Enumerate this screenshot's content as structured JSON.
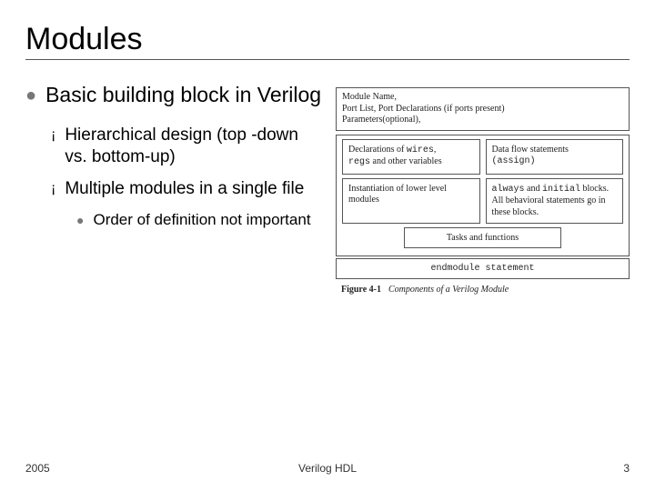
{
  "title": "Modules",
  "main_bullet": "Basic building block in Verilog",
  "sub": {
    "a": "Hierarchical design (top -down vs. bottom-up)",
    "b": "Multiple modules in a single file"
  },
  "subsub": "Order of definition not important",
  "footer": {
    "left": "2005",
    "center": "Verilog HDL",
    "right": "3"
  },
  "diagram": {
    "header_l1": "Module Name,",
    "header_l2": "Port List, Port Declarations (if ports present)",
    "header_l3": "Parameters(optional),",
    "row1": {
      "left_plain1": "Declarations of ",
      "left_mono1": "wires",
      "left_plain2": ",",
      "left_mono2": "regs",
      "left_plain3": " and other variables",
      "right_plain": "Data flow statements",
      "right_mono": "(assign)"
    },
    "row2": {
      "left": "Instantiation of lower level modules",
      "right_l1a": "always",
      "right_l1mid": " and ",
      "right_l1b": "initial",
      "right_l1end": " blocks.",
      "right_l2": "All behavioral statements go in these blocks."
    },
    "tasks": "Tasks and functions",
    "endmod": "endmodule statement",
    "caption_ref": "Figure 4-1",
    "caption_text": "Components of a Verilog Module"
  }
}
